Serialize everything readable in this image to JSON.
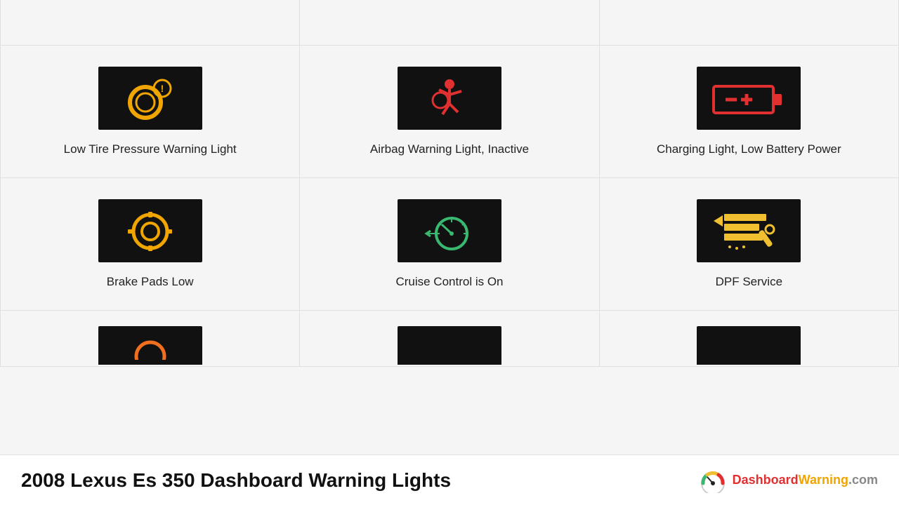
{
  "page": {
    "title": "2008 Lexus Es 350 Dashboard Warning Lights",
    "logo_text": "DashboardWarning.com"
  },
  "grid": {
    "top_row": [
      {
        "id": "top-1",
        "label": ""
      },
      {
        "id": "top-2",
        "label": ""
      },
      {
        "id": "top-3",
        "label": ""
      }
    ],
    "middle_row": [
      {
        "id": "low-tire",
        "label": "Low Tire Pressure Warning Light",
        "icon_color": "#f0a500",
        "bg": "#111"
      },
      {
        "id": "airbag",
        "label": "Airbag Warning Light, Inactive",
        "icon_color": "#e03030",
        "bg": "#111"
      },
      {
        "id": "charging",
        "label": "Charging Light, Low Battery Power",
        "icon_color": "#e03030",
        "bg": "#111"
      }
    ],
    "lower_row": [
      {
        "id": "brake-pads",
        "label": "Brake Pads Low",
        "icon_color": "#f0a500",
        "bg": "#111"
      },
      {
        "id": "cruise-control",
        "label": "Cruise Control is On",
        "icon_color": "#3ab870",
        "bg": "#111"
      },
      {
        "id": "dpf-service",
        "label": "DPF Service",
        "icon_color": "#f0c030",
        "bg": "#111"
      }
    ],
    "partial_row": [
      {
        "id": "partial-1"
      },
      {
        "id": "partial-2"
      },
      {
        "id": "partial-3"
      }
    ]
  }
}
